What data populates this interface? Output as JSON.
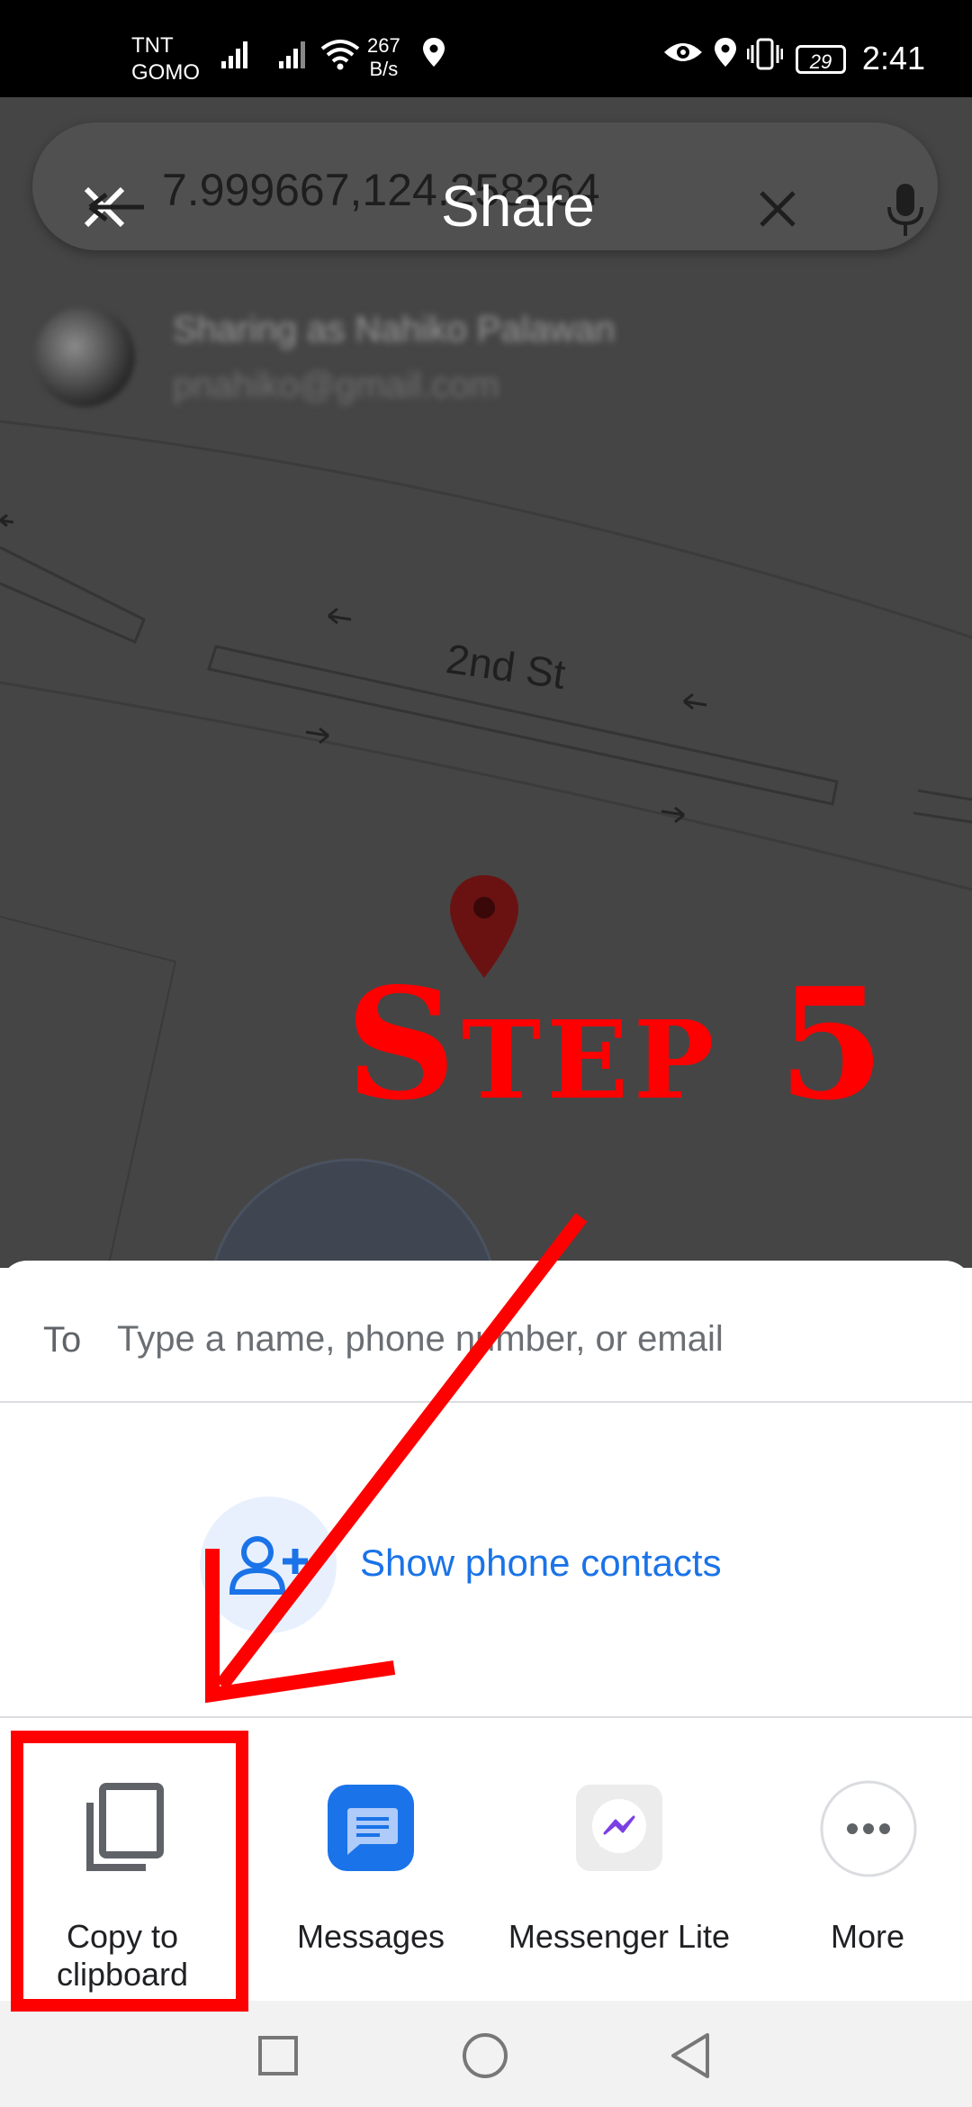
{
  "status_bar": {
    "carrier_1": "TNT",
    "carrier_2": "GOMO",
    "net_speed_value": "267",
    "net_speed_unit": "B/s",
    "battery": "29",
    "time": "2:41"
  },
  "search": {
    "query": "7.999667,124.258264",
    "overlay_title": "Share"
  },
  "account": {
    "name": "Sharing as Nahiko Palawan",
    "email": "pnahiko@gmail.com"
  },
  "map": {
    "street_label": "2nd St"
  },
  "annotation": {
    "step_label": "Step 5",
    "color": "#ff0000"
  },
  "share_sheet": {
    "to_label": "To",
    "to_placeholder": "Type a name, phone number, or email",
    "contacts_label": "Show phone contacts",
    "apps": [
      {
        "label_line1": "Copy to",
        "label_line2": "clipboard",
        "icon": "copy-icon"
      },
      {
        "label": "Messages",
        "icon": "messages-icon"
      },
      {
        "label": "Messenger Lite",
        "icon": "messenger-lite-icon"
      },
      {
        "label": "More",
        "icon": "more-icon"
      }
    ]
  },
  "colors": {
    "accent_blue": "#1a73e8",
    "messages_blue": "#1a73e8"
  }
}
